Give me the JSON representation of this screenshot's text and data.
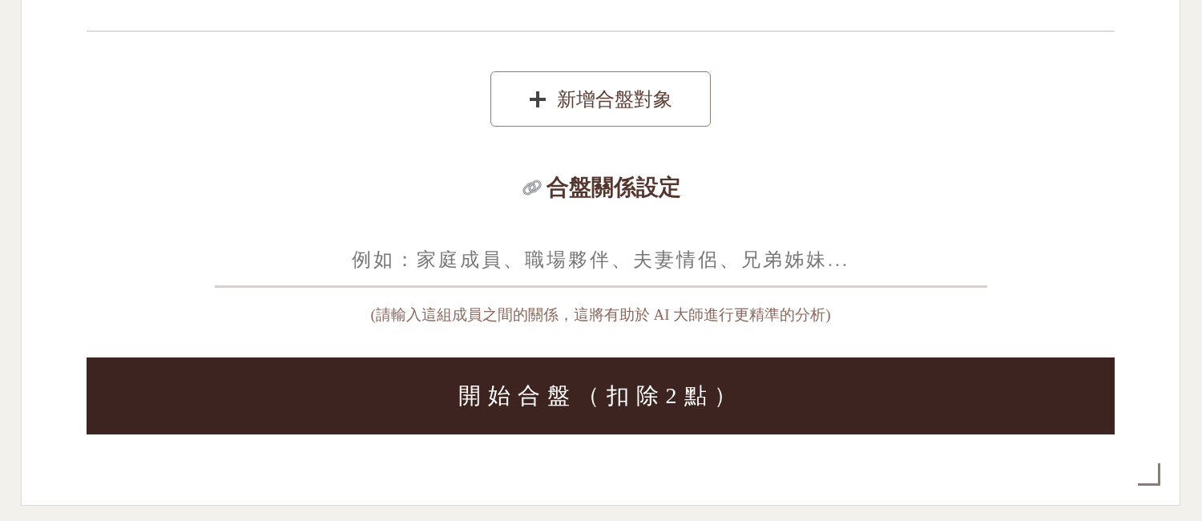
{
  "add_button": {
    "label": "新增合盤對象"
  },
  "relationship_section": {
    "title": "合盤關係設定",
    "input": {
      "placeholder": "例如：家庭成員、職場夥伴、夫妻情侶、兄弟姊妹..."
    },
    "hint": "(請輸入這組成員之間的關係，這將有助於 AI 大師進行更精準的分析)"
  },
  "submit_button": {
    "label": "開始合盤（扣除2點）"
  }
}
